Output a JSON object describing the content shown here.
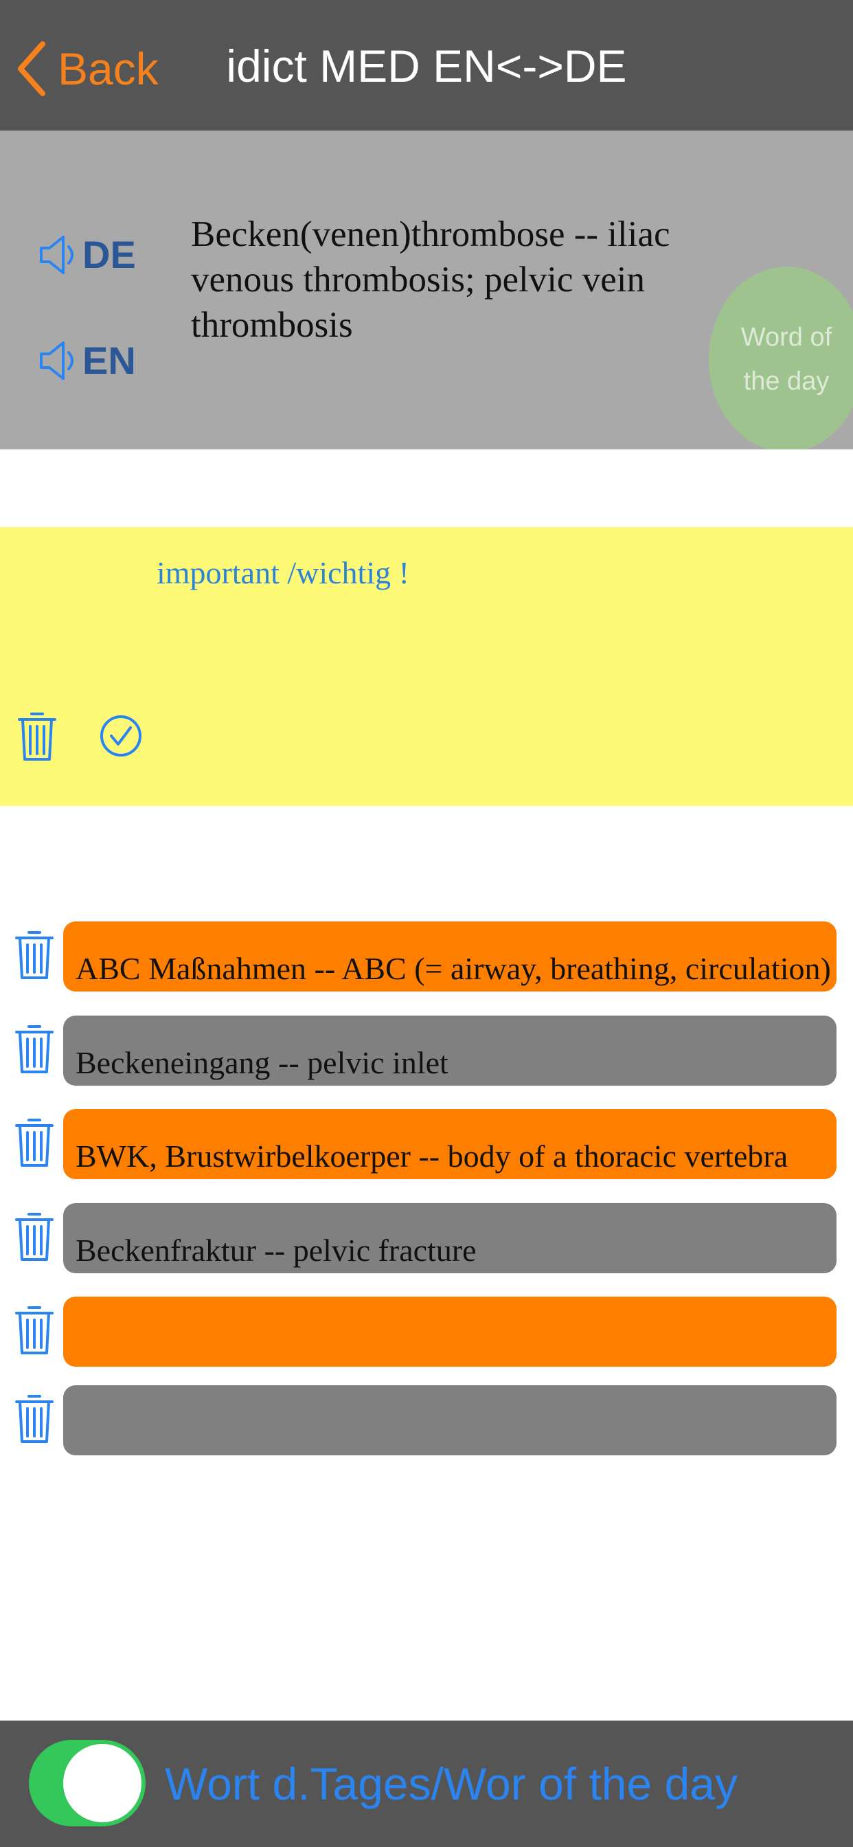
{
  "nav": {
    "back_label": "Back",
    "title": "idict MED EN<->DE",
    "back_icon": "chevron-left-icon"
  },
  "word": {
    "de_label": "DE",
    "en_label": "EN",
    "speaker_icon": "speaker-icon",
    "text": "Becken(venen)thrombose -- iliac venous thrombosis; pelvic vein thrombosis",
    "badge": "Word of the day"
  },
  "note": {
    "text": "important /wichtig !",
    "delete_icon": "trash-icon",
    "confirm_icon": "checkmark-circle-icon"
  },
  "history": [
    {
      "text": "ABC Maßnahmen -- ABC (= airway, breathing, circulation) of",
      "color": "orange"
    },
    {
      "text": "Beckeneingang -- pelvic inlet",
      "color": "gray"
    },
    {
      "text": "BWK, Brustwirbelkoerper -- body of a thoracic vertebra",
      "color": "orange"
    },
    {
      "text": "Beckenfraktur -- pelvic fracture",
      "color": "gray"
    },
    {
      "text": "",
      "color": "orange"
    },
    {
      "text": "",
      "color": "gray"
    }
  ],
  "bottom": {
    "toggle_on": true,
    "label": "Wort d.Tages/Wor of the day"
  },
  "colors": {
    "accent_orange": "#fe7f00",
    "link_blue": "#2b84f0",
    "toggle_green": "#34c759",
    "note_yellow": "#fef977"
  }
}
